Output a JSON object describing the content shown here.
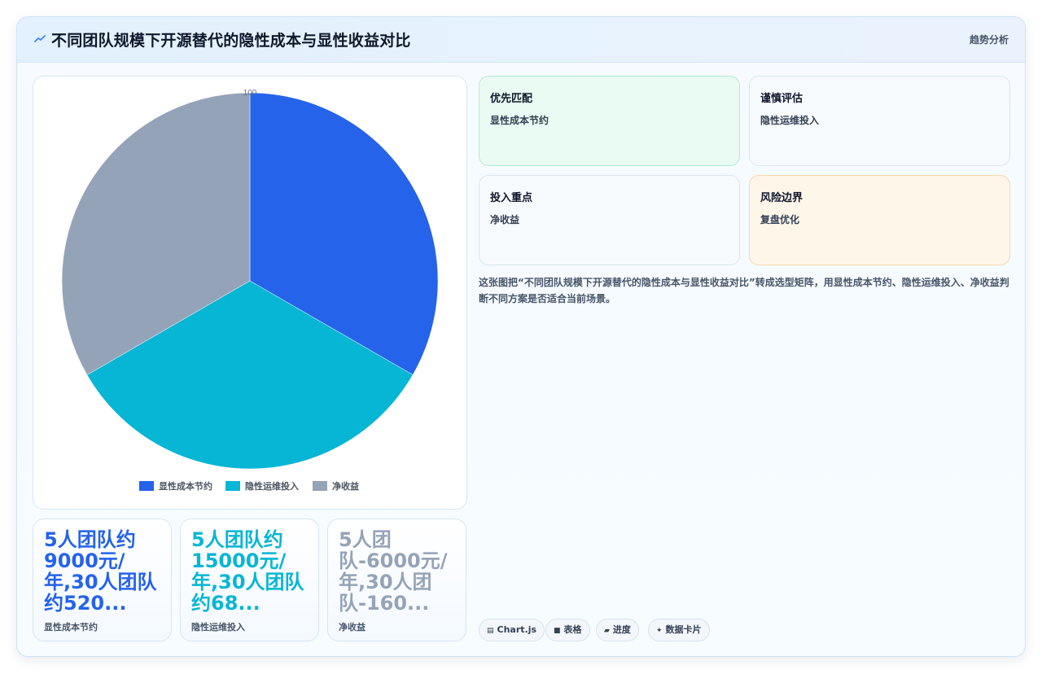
{
  "header": {
    "icon": "trend-line-icon",
    "title": "不同团队规模下开源替代的隐性成本与显性收益对比",
    "tag": "趋势分析"
  },
  "chart_data": {
    "type": "pie",
    "categories": [
      "显性成本节约",
      "隐性运维投入",
      "净收益"
    ],
    "values": [
      33.33,
      33.33,
      33.34
    ],
    "colors": [
      "#2563eb",
      "#06b6d4",
      "#94a3b8"
    ],
    "top_label": "100",
    "legend_position": "bottom"
  },
  "stats": [
    {
      "value": "5人团队约9000元/年,30人团队约520...",
      "label": "显性成本节约",
      "color": "#2563eb"
    },
    {
      "value": "5人团队约15000元/年,30人团队约68...",
      "label": "隐性运维投入",
      "color": "#06b6d4"
    },
    {
      "value": "5人团队-6000元/年,30人团队-160...",
      "label": "净收益",
      "color": "#94a3b8"
    }
  ],
  "matrix": [
    {
      "title": "优先匹配",
      "subtitle": "显性成本节约",
      "bg": "#e9fbf3",
      "border": "#b6ecd2"
    },
    {
      "title": "谨慎评估",
      "subtitle": "隐性运维投入",
      "bg": "#f7fafd",
      "border": "#d9e6f2"
    },
    {
      "title": "投入重点",
      "subtitle": "净收益",
      "bg": "#f7fafd",
      "border": "#d9e6f2"
    },
    {
      "title": "风险边界",
      "subtitle": "复盘优化",
      "bg": "#fff6ea",
      "border": "#f5d9a8"
    }
  ],
  "description": "这张图把“不同团队规模下开源替代的隐性成本与显性收益对比”转成选型矩阵，用显性成本节约、隐性运维投入、净收益判断不同方案是否适合当前场景。",
  "chips": [
    {
      "icon": "chart-icon",
      "glyph": "▤",
      "label": "Chart.js"
    },
    {
      "icon": "table-icon",
      "glyph": "■",
      "label": "表格"
    },
    {
      "icon": "progress-icon",
      "glyph": "▰",
      "label": "进度"
    },
    {
      "icon": "sparkle-icon",
      "glyph": "✦",
      "label": "数据卡片"
    }
  ]
}
